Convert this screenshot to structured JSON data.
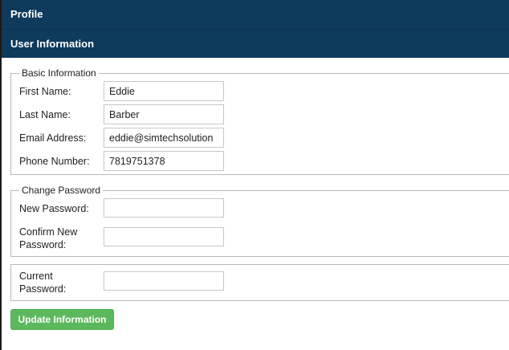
{
  "header": {
    "title": "Profile"
  },
  "section": {
    "title": "User Information"
  },
  "basic_info": {
    "legend": "Basic Information",
    "first_name": {
      "label": "First Name:",
      "value": "Eddie"
    },
    "last_name": {
      "label": "Last Name:",
      "value": "Barber"
    },
    "email": {
      "label": "Email Address:",
      "value": "eddie@simtechsolution"
    },
    "phone": {
      "label": "Phone Number:",
      "value": "7819751378"
    }
  },
  "change_password": {
    "legend": "Change Password",
    "new_password": {
      "label": "New Password:",
      "value": ""
    },
    "confirm_password": {
      "label_line1": "Confirm New",
      "label_line2": "Password:",
      "value": ""
    }
  },
  "current_password": {
    "label_line1": "Current",
    "label_line2": "Password:",
    "value": ""
  },
  "actions": {
    "update_label": "Update Information",
    "color": "#5cb85c"
  },
  "colors": {
    "header_bg": "#0e3a5c"
  }
}
